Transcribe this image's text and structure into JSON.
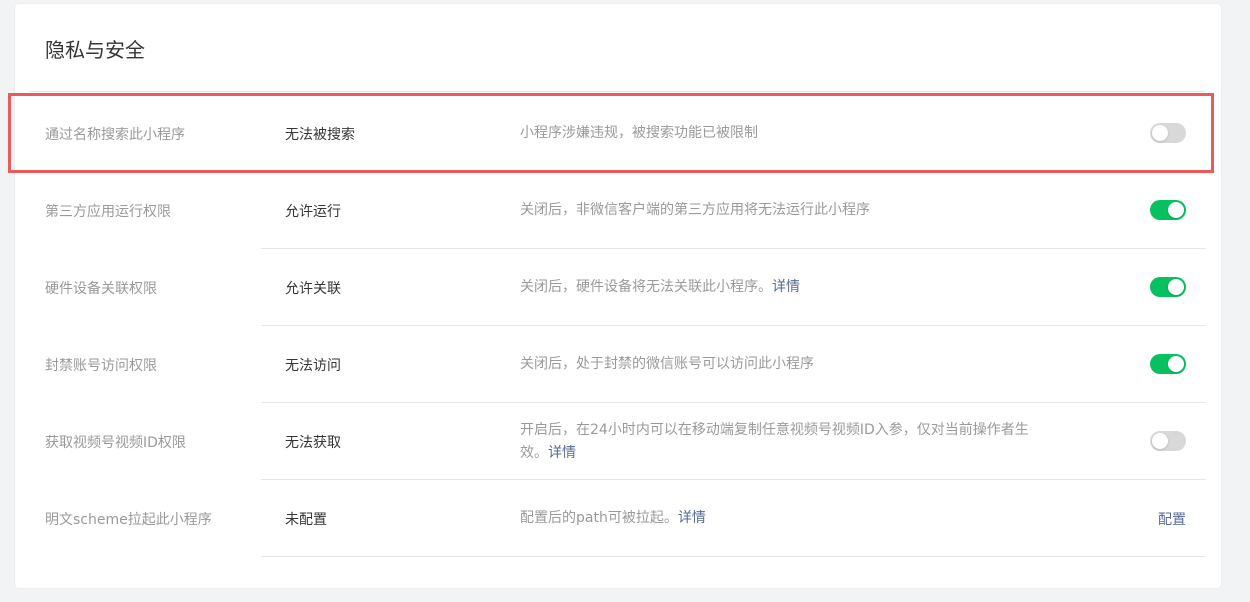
{
  "page": {
    "title": "隐私与安全"
  },
  "rows": [
    {
      "label": "通过名称搜索此小程序",
      "value": "无法被搜索",
      "desc": "小程序涉嫌违规，被搜索功能已被限制",
      "link": "",
      "toggle": "off"
    },
    {
      "label": "第三方应用运行权限",
      "value": "允许运行",
      "desc": "关闭后，非微信客户端的第三方应用将无法运行此小程序",
      "link": "",
      "toggle": "on"
    },
    {
      "label": "硬件设备关联权限",
      "value": "允许关联",
      "desc": "关闭后，硬件设备将无法关联此小程序。",
      "link": "详情",
      "toggle": "on"
    },
    {
      "label": "封禁账号访问权限",
      "value": "无法访问",
      "desc": "关闭后，处于封禁的微信账号可以访问此小程序",
      "link": "",
      "toggle": "on"
    },
    {
      "label": "获取视频号视频ID权限",
      "value": "无法获取",
      "desc": "开启后，在24小时内可以在移动端复制任意视频号视频ID入参，仅对当前操作者生效。",
      "link": "详情",
      "toggle": "off"
    },
    {
      "label": "明文scheme拉起此小程序",
      "value": "未配置",
      "desc": "配置后的path可被拉起。",
      "link": "详情",
      "action": "配置"
    }
  ],
  "colors": {
    "toggle_on": "#07c160",
    "toggle_off": "#d8d8d8",
    "link": "#576b95",
    "highlight": "#ec5b5b"
  },
  "icons": {
    "toggle": "toggle-switch"
  }
}
